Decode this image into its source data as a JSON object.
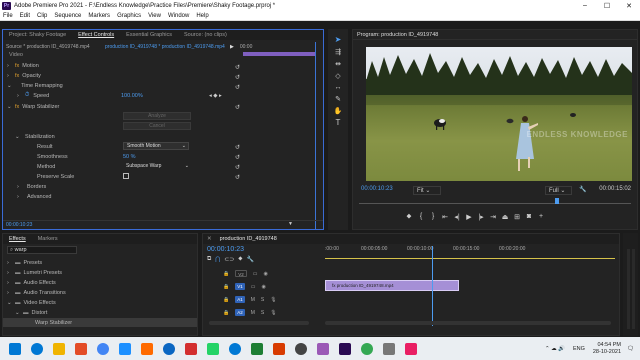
{
  "title": "Adobe Premiere Pro 2021 - F:\\Endless Knowledge\\Practice Files\\Premiere\\Shaky Footage.prproj *",
  "menu": [
    "File",
    "Edit",
    "Clip",
    "Sequence",
    "Markers",
    "Graphics",
    "View",
    "Window",
    "Help"
  ],
  "left_panel": {
    "tabs": [
      "Project: Shaky Footage",
      "Effect Controls",
      "Essential Graphics",
      "Source: (no clips)"
    ],
    "source_label": "Source * production ID_4919748.mp4",
    "clip_label": "production ID_4919748 * production ID_4919748.mp4",
    "section_video": "Video",
    "motion": "Motion",
    "opacity": "Opacity",
    "time_remapping": "Time Remapping",
    "speed_label": "Speed",
    "speed_value": "100.00%",
    "warp_stabilizer": "Warp Stabilizer",
    "analyze": "Analyze",
    "cancel": "Cancel",
    "stabilization": "Stabilization",
    "result_label": "Result",
    "result_value": "Smooth Motion",
    "smoothness_label": "Smoothness",
    "smoothness_value": "50 %",
    "method_label": "Method",
    "method_value": "Subspace Warp",
    "preserve_scale": "Preserve Scale",
    "borders": "Borders",
    "advanced": "Advanced",
    "timecode": "00:00:10:23",
    "mini_tl_label": "00:00"
  },
  "program": {
    "title": "Program: production ID_4919748",
    "timecode": "00:00:10:23",
    "fit": "Fit",
    "full": "Full",
    "duration": "00:00:15:02",
    "watermark": "ENDLESS KNOWLEDGE"
  },
  "effects": {
    "tabs": [
      "Effects",
      "Markers"
    ],
    "search": "warp",
    "items": [
      "Presets",
      "Lumetri Presets",
      "Audio Effects",
      "Audio Transitions",
      "Video Effects",
      "Distort",
      "Warp Stabilizer"
    ]
  },
  "timeline": {
    "tab": "production ID_4919748",
    "timecode": "00:00:10:23",
    "ruler": [
      ":00:00",
      "00:00:05:00",
      "00:00:10:00",
      "00:00:15:00",
      "00:00:20:00"
    ],
    "tracks": [
      "V2",
      "V1",
      "A1",
      "A2"
    ],
    "clip_name": "production ID_4919748.mp4",
    "playhead_fraction": 0.37
  },
  "taskbar": {
    "time": "04:54 PM",
    "date": "28-10-2021",
    "lang": "ENG",
    "icon_colors": [
      "#0078d4",
      "#f0b400",
      "#e34c26",
      "#4285f4",
      "#1e90ff",
      "#ff6a00",
      "#0a66c2",
      "#d32f2f",
      "#25d366",
      "#0078d4",
      "#1e7e34",
      "#d83b01",
      "#444444",
      "#9b59b6",
      "#2a0a52",
      "#34a853",
      "#777777",
      "#e91e63"
    ]
  }
}
